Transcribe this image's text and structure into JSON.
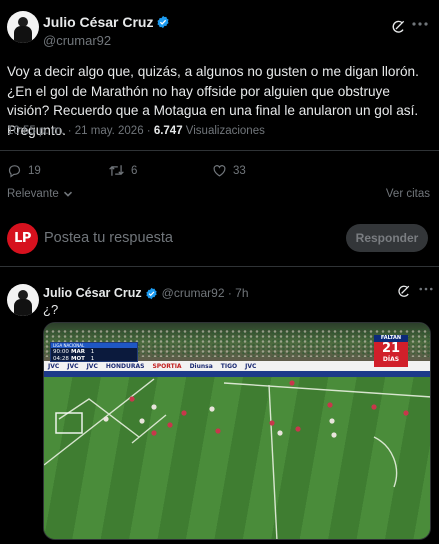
{
  "main_tweet": {
    "display_name": "Julio César Cruz",
    "handle": "@crumar92",
    "text": "Voy a decir algo que, quizás, a algunos no gusten o me digan llorón. ¿En el gol de Marathón no hay offside por alguien que obstruye visión? Recuerdo que a Motagua en una final le anularon un gol así. Pregunto.",
    "timestamp": "10:55 p. m. · 21 may. 2026 · ",
    "views_count": "6.747",
    "views_label": " Visualizaciones",
    "replies": "19",
    "reposts": "6",
    "likes": "33"
  },
  "sort": {
    "left_label": "Relevante",
    "right_label": "Ver citas"
  },
  "reply_box": {
    "avatar_text": "LP",
    "placeholder": "Postea tu respuesta",
    "button_label": "Responder"
  },
  "quoted_tweet": {
    "display_name": "Julio César Cruz",
    "handle_time": "@crumar92 · 7h",
    "text": "¿?"
  },
  "media": {
    "scorebug_top": "LIGA NACIONAL",
    "row1": {
      "time": "90:00",
      "team": "MAR",
      "score": "1"
    },
    "row2": {
      "time": "04:28",
      "team": "MOT",
      "score": "1"
    },
    "countdown_top": "FALTAN",
    "countdown_num": "21",
    "countdown_bottom": "DÍAS",
    "ads": [
      "JVC",
      "JVC",
      "JVC",
      "HONDURAS",
      "SPORTIA",
      "Diunsa",
      "TIGO",
      "JVC"
    ]
  },
  "colors": {
    "background": "#000000",
    "text": "#e7e9ea",
    "muted": "#71767b",
    "verified": "#1d9bf0",
    "divider": "#2f3336",
    "lp_red": "#d6111e"
  },
  "icons": [
    "verified-badge-icon",
    "grok-icon",
    "more-icon",
    "reply-icon",
    "repost-icon",
    "like-icon",
    "chevron-down-icon"
  ]
}
